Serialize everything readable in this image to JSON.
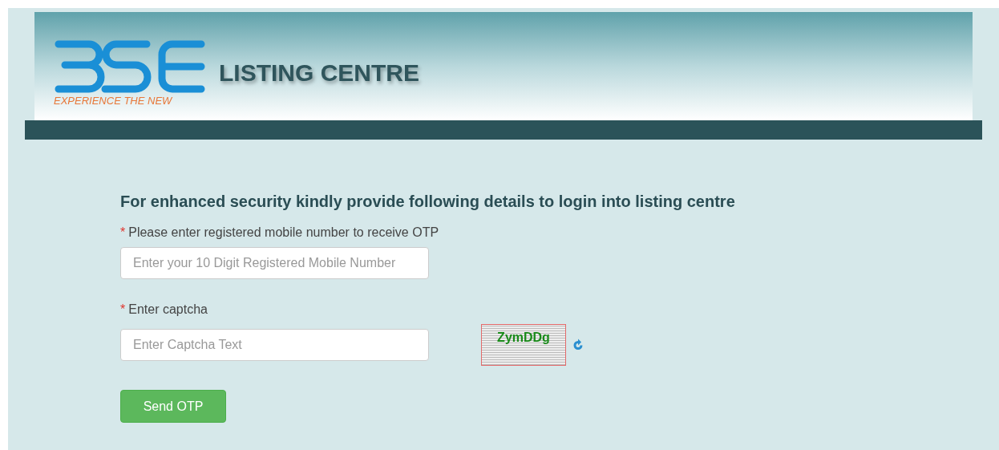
{
  "header": {
    "title": "LISTING CENTRE",
    "tagline": "EXPERIENCE THE NEW"
  },
  "form": {
    "heading": "For enhanced security kindly provide following details to login into listing centre",
    "fields": [
      {
        "label": "Please enter registered mobile number to receive OTP",
        "required_mark": "*",
        "placeholder": "Enter your 10 Digit Registered Mobile Number"
      },
      {
        "label": "Enter captcha",
        "required_mark": "*",
        "placeholder": "Enter Captcha Text"
      }
    ],
    "captcha": {
      "text": "ZymDDg"
    },
    "button": "Send OTP"
  }
}
